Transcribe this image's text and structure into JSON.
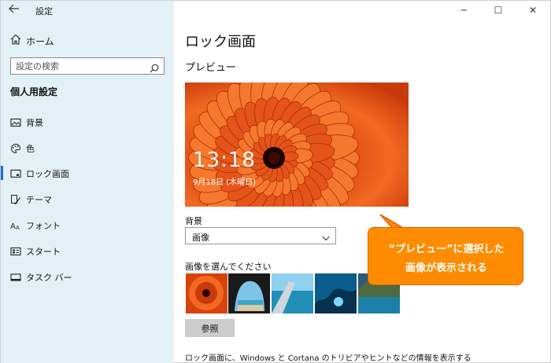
{
  "window": {
    "title": "設定",
    "back_icon": "back-arrow-icon",
    "controls": {
      "minimize": "─",
      "maximize": "☐",
      "close": "✕"
    }
  },
  "sidebar": {
    "home_label": "ホーム",
    "search_placeholder": "設定の検索",
    "section_heading": "個人用設定",
    "items": [
      {
        "label": "背景",
        "icon": "picture-icon"
      },
      {
        "label": "色",
        "icon": "palette-icon"
      },
      {
        "label": "ロック画面",
        "icon": "lock-screen-icon",
        "selected": true
      },
      {
        "label": "テーマ",
        "icon": "theme-brush-icon"
      },
      {
        "label": "フォント",
        "icon": "font-icon"
      },
      {
        "label": "スタート",
        "icon": "start-icon"
      },
      {
        "label": "タスク バー",
        "icon": "taskbar-icon"
      }
    ]
  },
  "main": {
    "title": "ロック画面",
    "preview_heading": "プレビュー",
    "preview_time": "13:18",
    "preview_date": "9月18日 (木曜日)",
    "background_label": "背景",
    "background_value": "画像",
    "choose_image_label": "画像を選んでください",
    "browse_button": "参照",
    "bottom_text": "ロック画面に、Windows と Cortana のトリビアやヒントなどの情報を表示する"
  },
  "callout": {
    "line1": "“プレビュー”に選択した",
    "line2": "画像が表示される"
  },
  "colors": {
    "sidebar_bg": "#e3f1f6",
    "accent": "#1a6fd2",
    "callout": "#ff8c00",
    "button": "#cccccc"
  }
}
